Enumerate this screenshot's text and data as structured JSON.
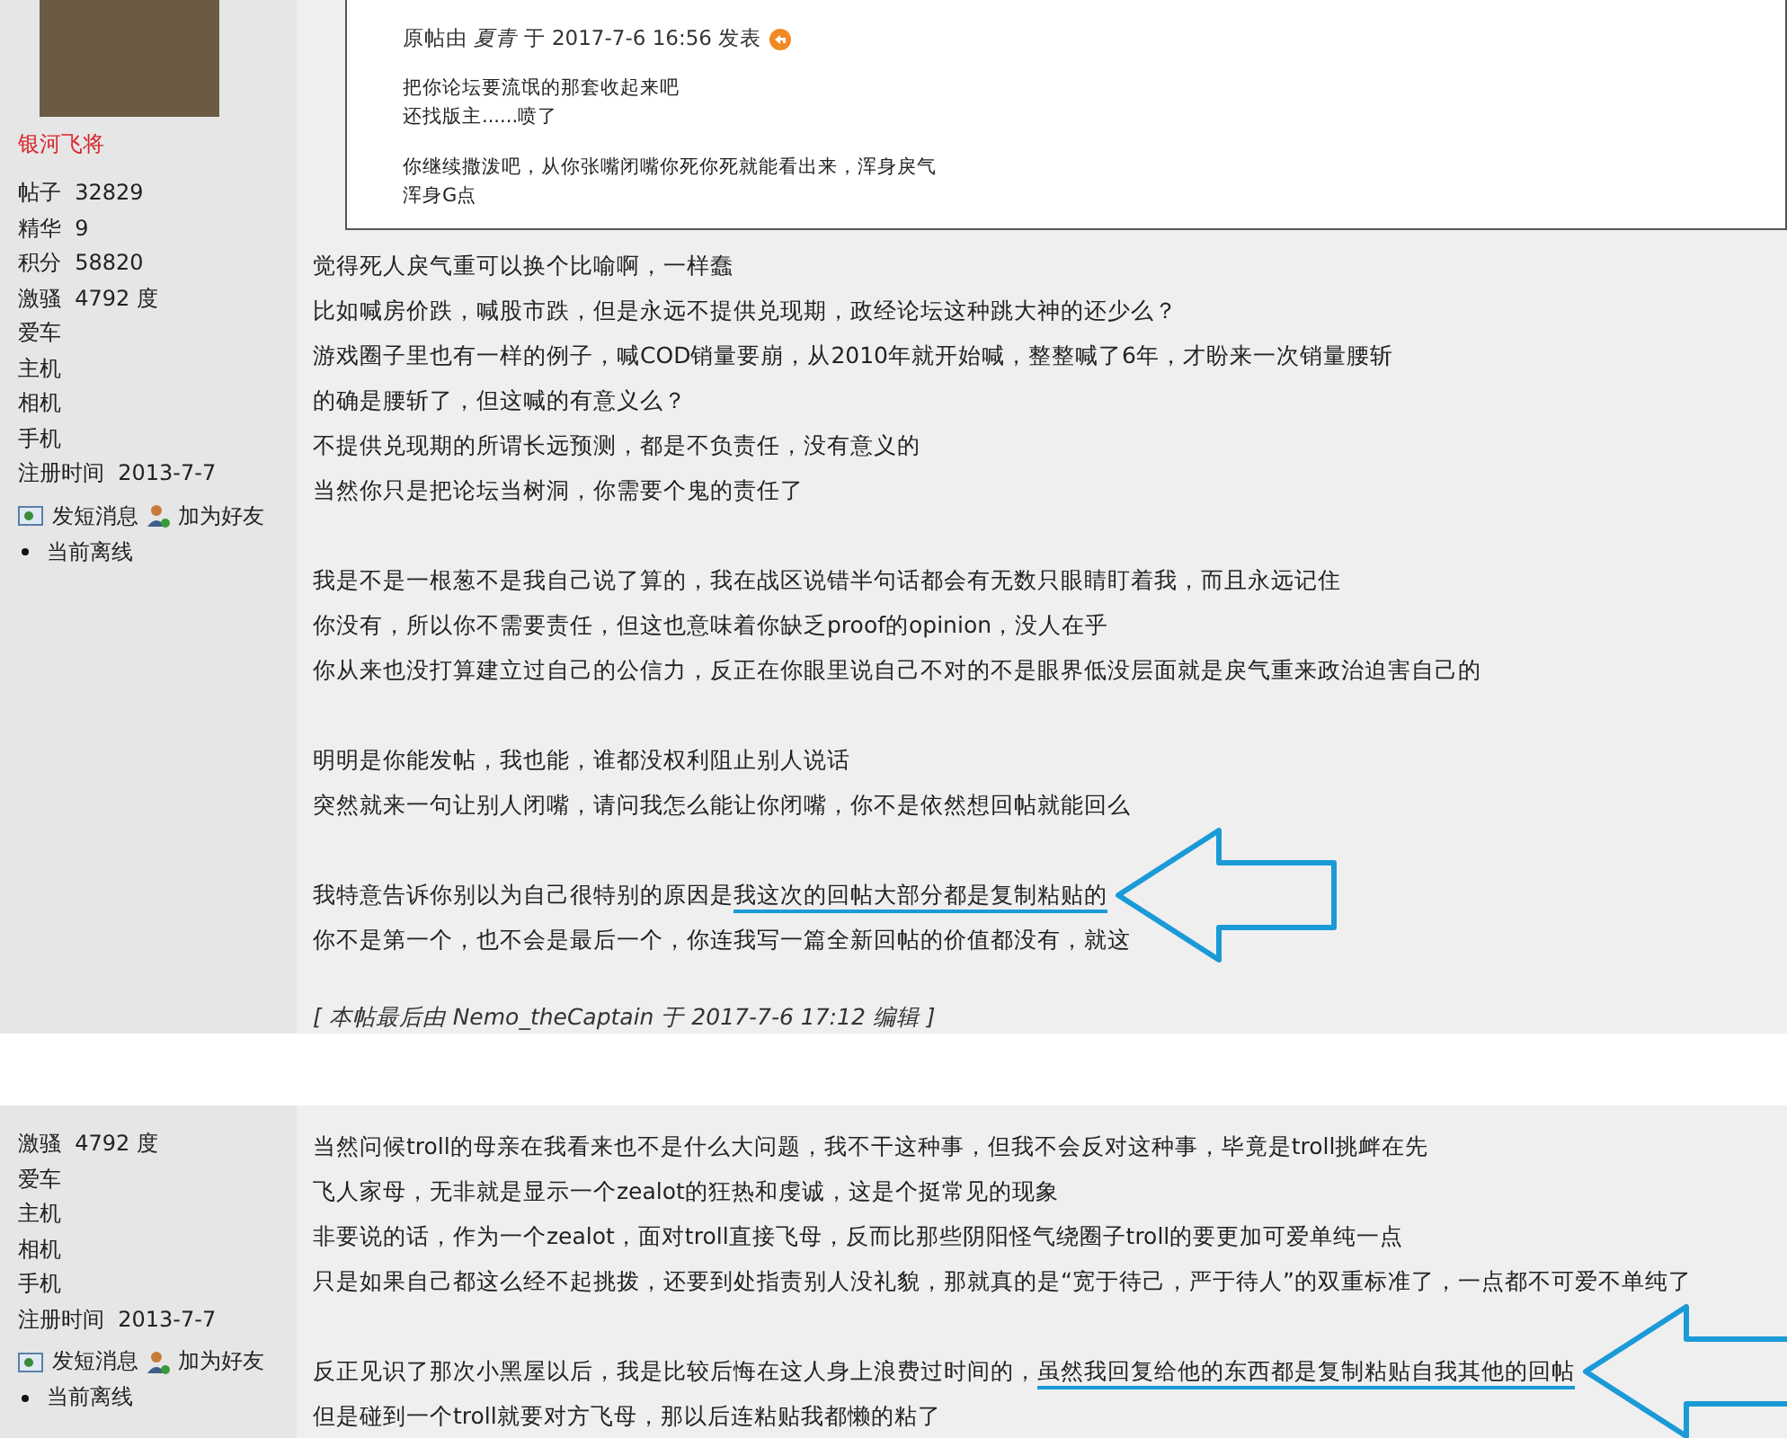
{
  "posts": [
    {
      "author": {
        "name": "银河飞将",
        "stats": [
          {
            "label": "帖子",
            "value": "32829"
          },
          {
            "label": "精华",
            "value": "9"
          },
          {
            "label": "积分",
            "value": "58820"
          },
          {
            "label": "激骚",
            "value": "4792 度"
          },
          {
            "label": "爱车"
          },
          {
            "label": "主机"
          },
          {
            "label": "相机"
          },
          {
            "label": "手机"
          },
          {
            "label": "注册时间",
            "value": "2013-7-7"
          }
        ],
        "actions": [
          {
            "kind": "message",
            "label": "发短消息"
          },
          {
            "kind": "friend",
            "label": "加为好友"
          }
        ],
        "status": "当前离线"
      },
      "quote": {
        "header": "原帖由 *夏青* 于 2017-7-6 16:56 发表",
        "paragraphs": [
          [
            "把你论坛要流氓的那套收起来吧",
            "还找版主......喷了"
          ],
          [
            "你继续撒泼吧，从你张嘴闭嘴你死你死就能看出来，浑身戾气",
            "浑身G点"
          ]
        ]
      },
      "paragraphs": [
        [
          {
            "text": "觉得死人戾气重可以换个比喻啊，一样蠢"
          },
          {
            "text": "比如喊房价跌，喊股市跌，但是永远不提供兑现期，政经论坛这种跳大神的还少么？"
          },
          {
            "text": "游戏圈子里也有一样的例子，喊COD销量要崩，从2010年就开始喊，整整喊了6年，才盼来一次销量腰斩"
          },
          {
            "text": "的确是腰斩了，但这喊的有意义么？"
          },
          {
            "text": "不提供兑现期的所谓长远预测，都是不负责任，没有意义的"
          },
          {
            "text": "当然你只是把论坛当树洞，你需要个鬼的责任了"
          }
        ],
        [
          {
            "text": "我是不是一根葱不是我自己说了算的，我在战区说错半句话都会有无数只眼睛盯着我，而且永远记住"
          },
          {
            "text": "你没有，所以你不需要责任，但这也意味着你缺乏proof的opinion，没人在乎"
          },
          {
            "text": "你从来也没打算建立过自己的公信力，反正在你眼里说自己不对的不是眼界低没层面就是戾气重来政治迫害自己的"
          }
        ],
        [
          {
            "text": "明明是你能发帖，我也能，谁都没权利阻止别人说话"
          },
          {
            "text": "突然就来一句让别人闭嘴，请问我怎么能让你闭嘴，你不是依然想回帖就能回么"
          }
        ],
        [
          {
            "text": "我特意告诉你别以为自己很特别的原因是",
            "marked": "我这次的回帖大部分都是复制粘贴的",
            "arrow": true
          },
          {
            "text": "你不是第一个，也不会是最后一个，你连我写一篇全新回帖的价值都没有，就这"
          }
        ]
      ],
      "edit_note": "[ 本帖最后由 Nemo_theCaptain 于 2017-7-6 17:12 编辑 ]"
    },
    {
      "author": {
        "stats": [
          {
            "label": "激骚",
            "value": "4792 度"
          },
          {
            "label": "爱车"
          },
          {
            "label": "主机"
          },
          {
            "label": "相机"
          },
          {
            "label": "手机"
          },
          {
            "label": "注册时间",
            "value": "2013-7-7"
          }
        ],
        "actions": [
          {
            "kind": "message",
            "label": "发短消息"
          },
          {
            "kind": "friend",
            "label": "加为好友"
          }
        ],
        "status": "当前离线"
      },
      "paragraphs": [
        [
          {
            "text": "当然问候troll的母亲在我看来也不是什么大问题，我不干这种事，但我不会反对这种事，毕竟是troll挑衅在先"
          },
          {
            "text": "飞人家母，无非就是显示一个zealot的狂热和虔诚，这是个挺常见的现象"
          },
          {
            "text": "非要说的话，作为一个zealot，面对troll直接飞母，反而比那些阴阳怪气绕圈子troll的要更加可爱单纯一点"
          },
          {
            "text": "只是如果自己都这么经不起挑拨，还要到处指责别人没礼貌，那就真的是“宽于待己，严于待人”的双重标准了，一点都不可爱不单纯了"
          }
        ],
        [
          {
            "text": "反正见识了那次小黑屋以后，我是比较后悔在这人身上浪费过时间的，",
            "marked": "虽然我回复给他的东西都是复制粘贴自我其他的回帖",
            "arrow": true
          },
          {
            "text": "但是碰到一个troll就要对方飞母，那以后连粘贴我都懒的粘了"
          }
        ]
      ]
    }
  ]
}
